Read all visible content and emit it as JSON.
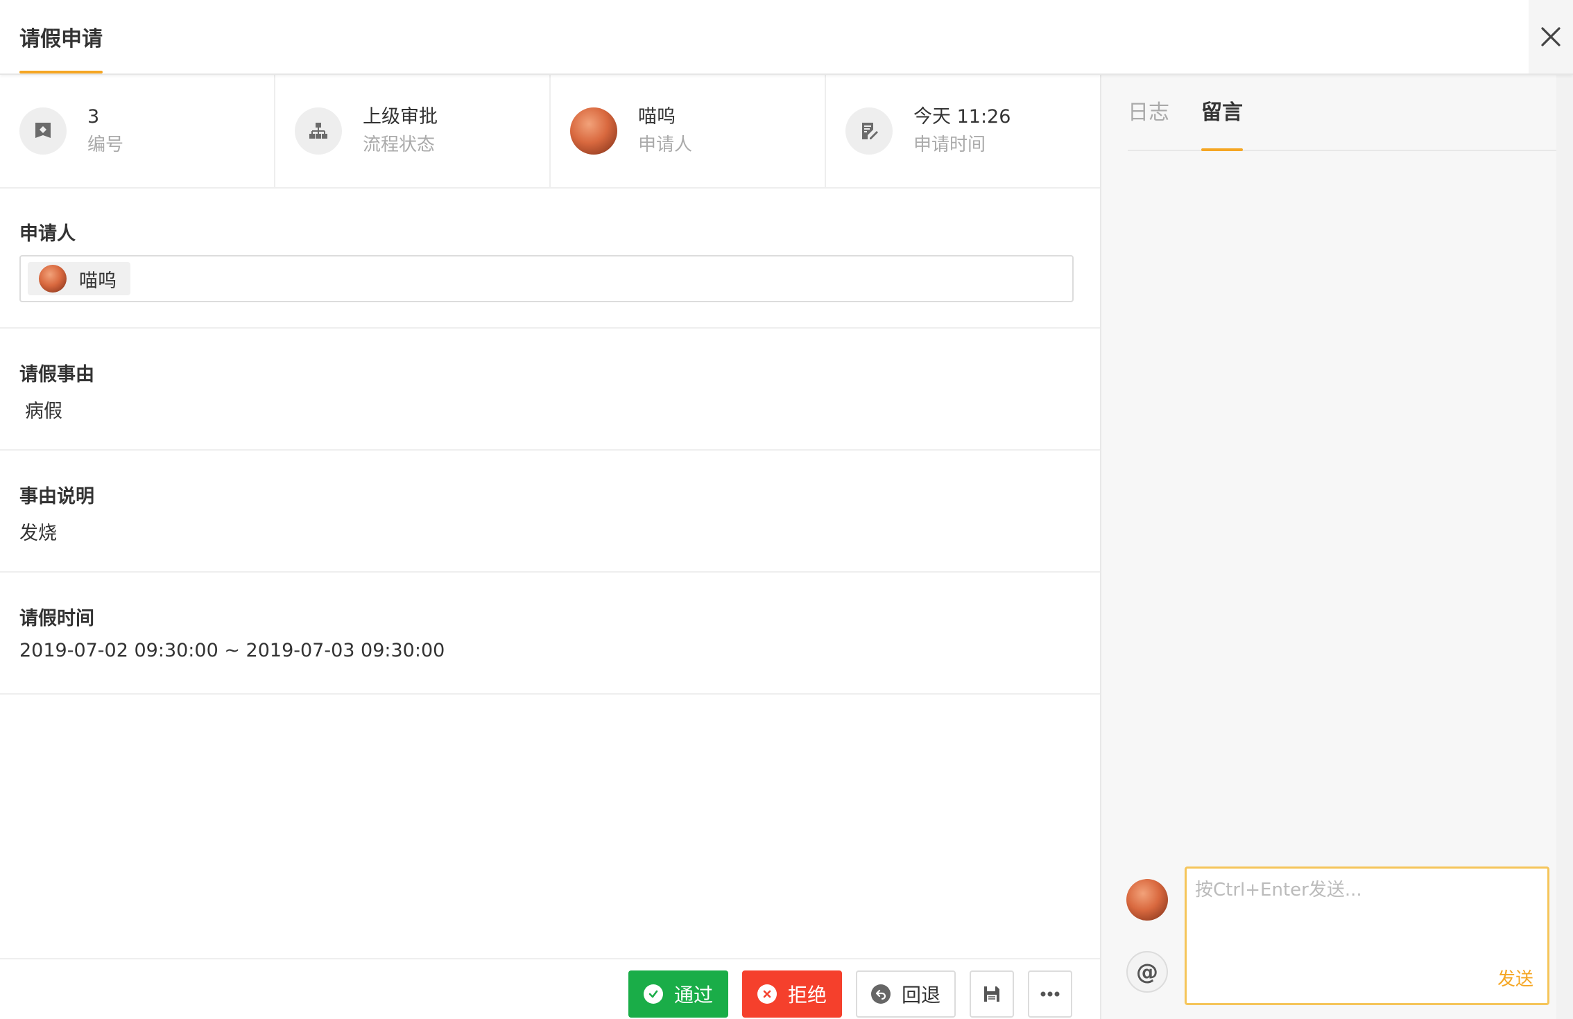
{
  "header": {
    "tab_label": "请假申请",
    "close_icon": "close-icon",
    "accent_color": "#f5a623"
  },
  "summary": [
    {
      "value": "3",
      "label": "编号",
      "icon": "tag-icon"
    },
    {
      "value": "上级审批",
      "label": "流程状态",
      "icon": "org-chart-icon"
    },
    {
      "value": "喵呜",
      "label": "申请人",
      "icon": "avatar"
    },
    {
      "value": "今天 11:26",
      "label": "申请时间",
      "icon": "edit-doc-icon"
    }
  ],
  "fields": {
    "applicant": {
      "label": "申请人",
      "user_name": "喵呜"
    },
    "reason": {
      "label": "请假事由",
      "value": "病假"
    },
    "description": {
      "label": "事由说明",
      "value": "发烧"
    },
    "time": {
      "label": "请假时间",
      "value": "2019-07-02 09:30:00 ~ 2019-07-03 09:30:00"
    }
  },
  "actions": {
    "approve_label": "通过",
    "reject_label": "拒绝",
    "back_label": "回退",
    "approve_color": "#1aad48",
    "reject_color": "#f5402c",
    "save_icon": "save-icon",
    "more_icon": "more-icon"
  },
  "side": {
    "tabs": [
      {
        "label": "日志",
        "active": false
      },
      {
        "label": "留言",
        "active": true
      }
    ],
    "at_label": "@",
    "input_placeholder": "按Ctrl+Enter发送...",
    "send_label": "发送"
  }
}
